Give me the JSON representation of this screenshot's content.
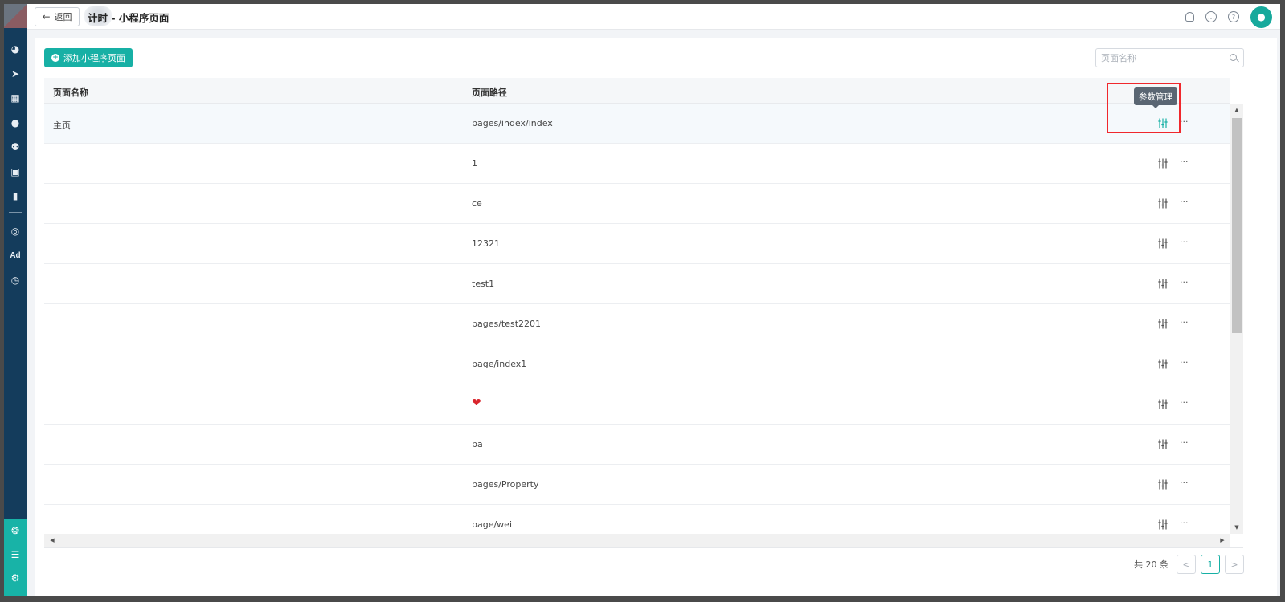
{
  "header": {
    "back_label": "返回",
    "title": "计时 - 小程序页面"
  },
  "toolbar": {
    "add_label": "添加小程序页面",
    "search_placeholder": "页面名称"
  },
  "sidebar": {
    "ad_label": "Ad"
  },
  "table": {
    "columns": [
      "页面名称",
      "页面路径"
    ],
    "rows": [
      {
        "name": "主页",
        "path": "pages/index/index"
      },
      {
        "name": "",
        "path": "1"
      },
      {
        "name": "",
        "path": "ce"
      },
      {
        "name": "",
        "path": "12321"
      },
      {
        "name": "",
        "path": "test1"
      },
      {
        "name": "",
        "path": "pages/test2201"
      },
      {
        "name": "",
        "path": "page/index1"
      },
      {
        "name": "",
        "path": "❤"
      },
      {
        "name": "",
        "path": "pa"
      },
      {
        "name": "",
        "path": "pages/Property"
      },
      {
        "name": "",
        "path": "page/wei"
      }
    ],
    "more_label": "···"
  },
  "tooltip": {
    "text": "参数管理"
  },
  "pagination": {
    "total": "共 20 条",
    "prev": "<",
    "current_page": "1",
    "next": ">"
  },
  "colors": {
    "accent": "#17b0a5",
    "sidebar": "#143c5c",
    "highlight": "#f0282d"
  }
}
